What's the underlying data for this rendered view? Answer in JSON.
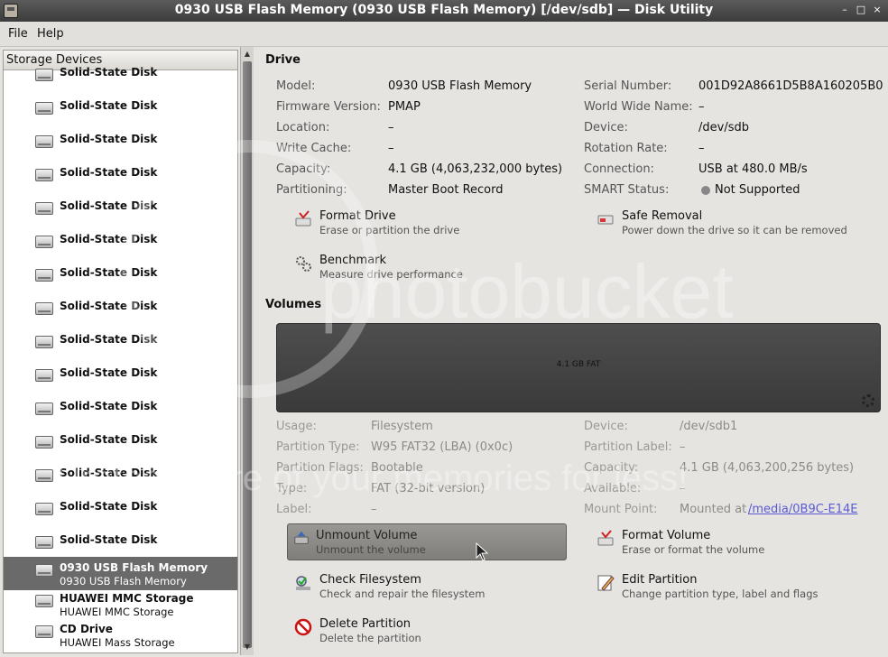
{
  "window": {
    "title": "0930 USB Flash Memory (0930 USB Flash Memory) [/dev/sdb] — Disk Utility",
    "minimize": "–",
    "maximize": "□",
    "close": "×"
  },
  "menu": {
    "file": "File",
    "help": "Help"
  },
  "sidebar": {
    "header": "Storage Devices",
    "items": [
      {
        "title": "Solid-State Disk",
        "sub": ""
      },
      {
        "title": "Solid-State Disk",
        "sub": ""
      },
      {
        "title": "Solid-State Disk",
        "sub": ""
      },
      {
        "title": "Solid-State Disk",
        "sub": ""
      },
      {
        "title": "Solid-State Disk",
        "sub": ""
      },
      {
        "title": "Solid-State Disk",
        "sub": ""
      },
      {
        "title": "Solid-State Disk",
        "sub": ""
      },
      {
        "title": "Solid-State Disk",
        "sub": ""
      },
      {
        "title": "Solid-State Disk",
        "sub": ""
      },
      {
        "title": "Solid-State Disk",
        "sub": ""
      },
      {
        "title": "Solid-State Disk",
        "sub": ""
      },
      {
        "title": "Solid-State Disk",
        "sub": ""
      },
      {
        "title": "Solid-State Disk",
        "sub": ""
      },
      {
        "title": "Solid-State Disk",
        "sub": ""
      },
      {
        "title": "Solid-State Disk",
        "sub": ""
      },
      {
        "title": "0930 USB Flash Memory",
        "sub": "0930 USB Flash Memory"
      },
      {
        "title": "HUAWEI MMC Storage",
        "sub": "HUAWEI MMC Storage"
      },
      {
        "title": "CD Drive",
        "sub": "HUAWEI Mass Storage"
      }
    ]
  },
  "drive": {
    "section_title": "Drive",
    "left": [
      {
        "label": "Model:",
        "value": "0930 USB Flash Memory"
      },
      {
        "label": "Firmware Version:",
        "value": "PMAP"
      },
      {
        "label": "Location:",
        "value": "–"
      },
      {
        "label": "Write Cache:",
        "value": "–"
      },
      {
        "label": "Capacity:",
        "value": "4.1 GB (4,063,232,000 bytes)"
      },
      {
        "label": "Partitioning:",
        "value": "Master Boot Record"
      }
    ],
    "right": [
      {
        "label": "Serial Number:",
        "value": "001D92A8661D5B8A160205B0"
      },
      {
        "label": "World Wide Name:",
        "value": "–"
      },
      {
        "label": "Device:",
        "value": "/dev/sdb"
      },
      {
        "label": "Rotation Rate:",
        "value": "–"
      },
      {
        "label": "Connection:",
        "value": "USB at 480.0 MB/s"
      },
      {
        "label": "SMART Status:",
        "value": "Not Supported"
      }
    ],
    "actions": {
      "format": {
        "title": "Format Drive",
        "desc": "Erase or partition the drive"
      },
      "safe_removal": {
        "title": "Safe Removal",
        "desc": "Power down the drive so it can be removed"
      },
      "benchmark": {
        "title": "Benchmark",
        "desc": "Measure drive performance"
      }
    }
  },
  "volumes": {
    "section_title": "Volumes",
    "bar_label": "4.1 GB FAT",
    "left": [
      {
        "label": "Usage:",
        "value": "Filesystem"
      },
      {
        "label": "Partition Type:",
        "value": "W95 FAT32 (LBA) (0x0c)"
      },
      {
        "label": "Partition Flags:",
        "value": "Bootable"
      },
      {
        "label": "Type:",
        "value": "FAT (32-bit version)"
      },
      {
        "label": "Label:",
        "value": "–"
      }
    ],
    "right": [
      {
        "label": "Device:",
        "value": "/dev/sdb1"
      },
      {
        "label": "Partition Label:",
        "value": "–"
      },
      {
        "label": "Capacity:",
        "value": "4.1 GB (4,063,200,256 bytes)"
      },
      {
        "label": "Available:",
        "value": "–"
      },
      {
        "label": "Mount Point:",
        "value": "Mounted at ",
        "link": "/media/0B9C-E14E"
      }
    ],
    "actions": {
      "unmount": {
        "title": "Unmount Volume",
        "desc": "Unmount the volume"
      },
      "format": {
        "title": "Format Volume",
        "desc": "Erase or format the volume"
      },
      "check": {
        "title": "Check Filesystem",
        "desc": "Check and repair the filesystem"
      },
      "edit": {
        "title": "Edit Partition",
        "desc": "Change partition type, label and flags"
      },
      "delete": {
        "title": "Delete Partition",
        "desc": "Delete the partition"
      }
    }
  },
  "watermark": {
    "brand": "photobucket",
    "tagline": "Protect more of your memories for less!"
  }
}
